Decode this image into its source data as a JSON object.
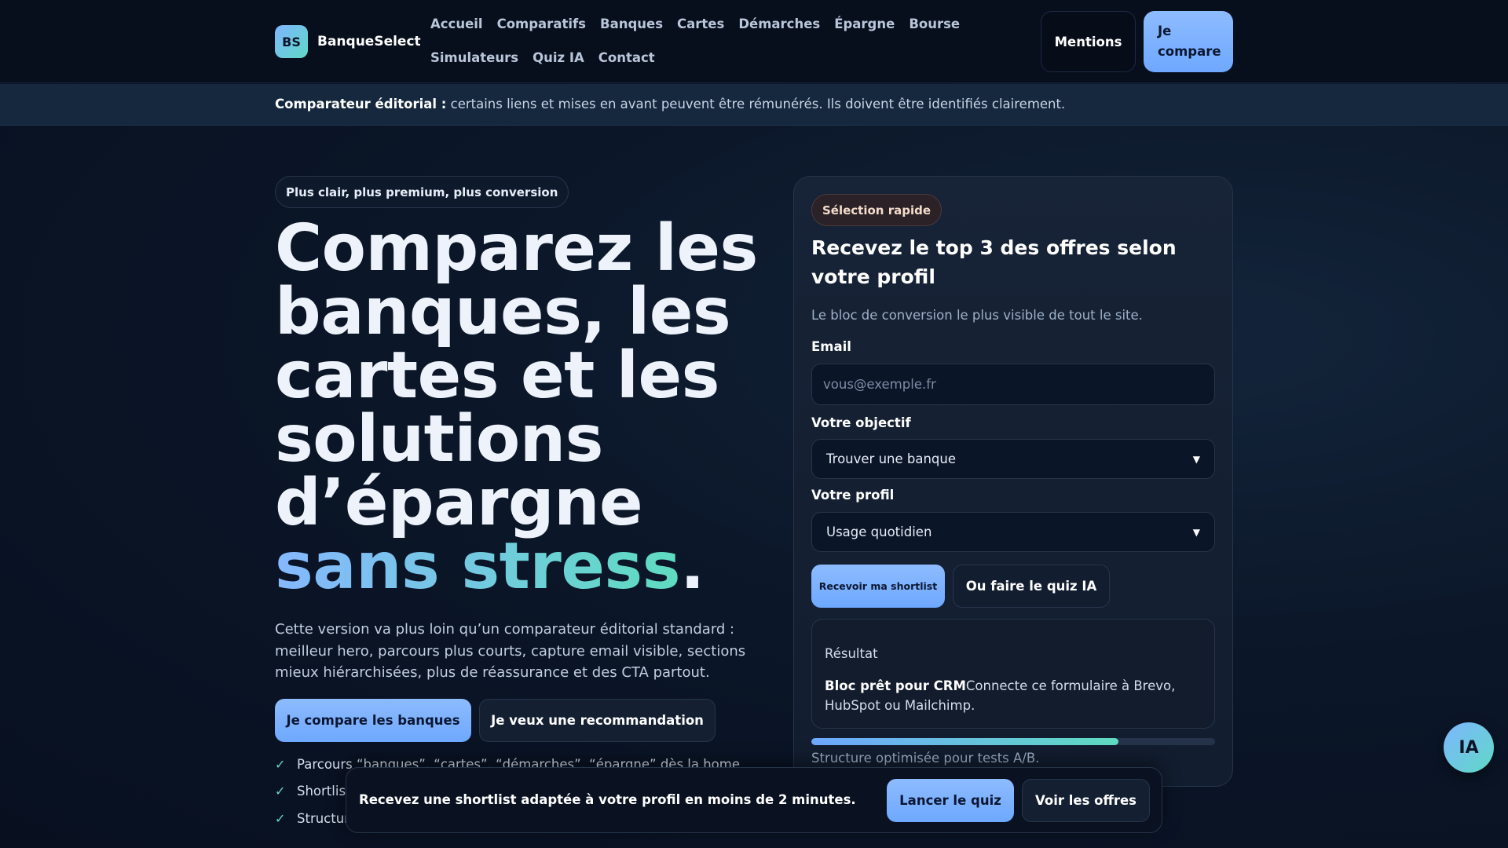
{
  "header": {
    "logo_initials": "BS",
    "brand_name": "BanqueSelect",
    "nav_row1": [
      "Accueil",
      "Comparatifs",
      "Banques",
      "Cartes",
      "Démarches",
      "Épargne",
      "Bourse"
    ],
    "nav_row2": [
      "Simulateurs",
      "Quiz IA",
      "Contact"
    ],
    "mentions_label": "Mentions",
    "compare_label": "Je compare"
  },
  "notice": {
    "bold": "Comparateur éditorial :",
    "text": " certains liens et mises en avant peuvent être rémunérés. Ils doivent être identifiés clairement."
  },
  "hero": {
    "pill": "Plus clair, plus premium, plus conversion",
    "title_main": "Comparez les banques, les cartes et les solutions d’épargne ",
    "title_highlight": "sans stress",
    "title_end": ".",
    "description": "Cette version va plus loin qu’un comparateur éditorial standard : meilleur hero, parcours plus courts, capture email visible, sections mieux hiérarchisées, plus de réassurance et des CTA partout.",
    "cta_primary": "Je compare les banques",
    "cta_secondary": "Je veux une recommandation",
    "check_mark": "✓",
    "checks": [
      "Parcours “banques”, “cartes”, “démarches”, “épargne” dès la home",
      "Shortlist",
      "Structur"
    ]
  },
  "form": {
    "badge": "Sélection rapide",
    "title": "Recevez le top 3 des offres selon votre profil",
    "subtitle": "Le bloc de conversion le plus visible de tout le site.",
    "email_label": "Email",
    "email_placeholder": "vous@exemple.fr",
    "objective_label": "Votre objectif",
    "objective_value": "Trouver une banque",
    "profile_label": "Votre profil",
    "profile_value": "Usage quotidien",
    "shortlist_button": "Recevoir ma shortlist",
    "quiz_button": "Ou faire le quiz IA",
    "result_label": "Résultat",
    "result_bold": "Bloc prêt pour CRM",
    "result_text": "Connecte ce formulaire à Brevo, HubSpot ou Mailchimp.",
    "progress_percent": 76,
    "progress_caption": "Structure optimisée pour tests A/B."
  },
  "sticky": {
    "text": "Recevez une shortlist adaptée à votre profil en moins de 2 minutes.",
    "launch_quiz": "Lancer le quiz",
    "see_offers": "Voir les offres"
  },
  "fab": {
    "label": "IA"
  },
  "colors": {
    "accent_blue": "#6ea8ff",
    "accent_teal": "#5fdcc0",
    "background": "#0b1628"
  }
}
